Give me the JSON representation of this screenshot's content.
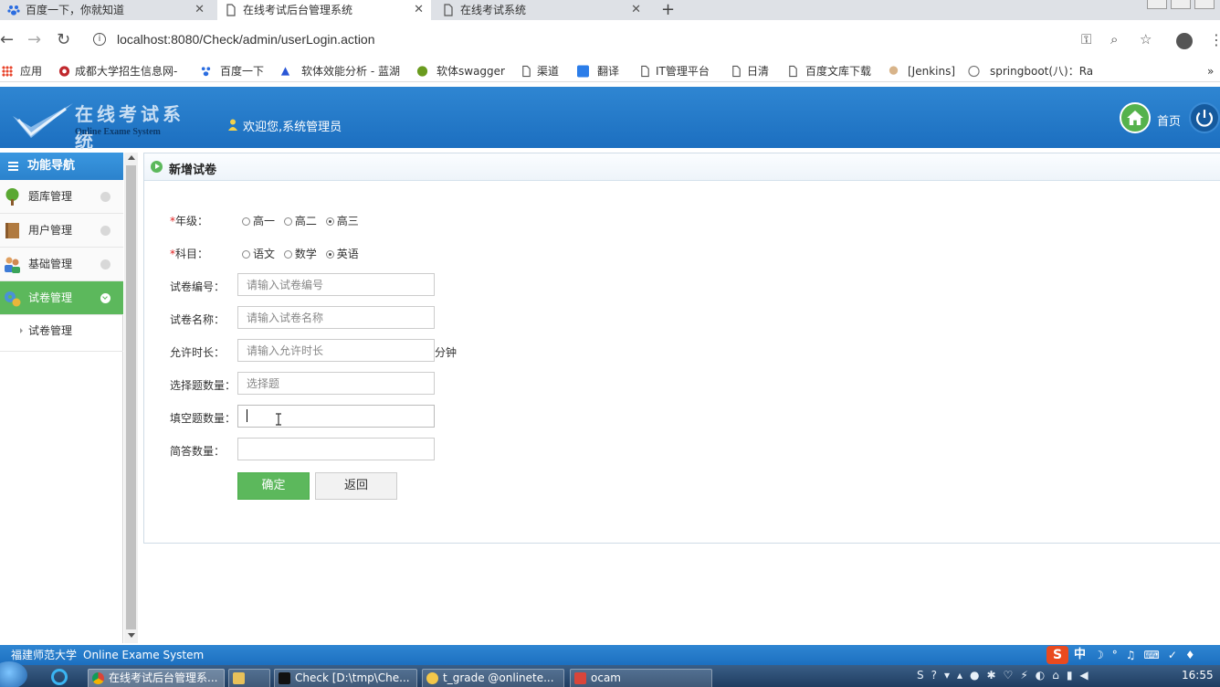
{
  "browser": {
    "tabs": [
      {
        "title": "百度一下，你就知道",
        "active": false
      },
      {
        "title": "在线考试后台管理系统",
        "active": true
      },
      {
        "title": "在线考试系统",
        "active": false
      }
    ],
    "url": "localhost:8080/Check/admin/userLogin.action",
    "bookmarks": [
      "应用",
      "成都大学招生信息网-",
      "百度一下",
      "软体效能分析 - 蓝湖",
      "软体swagger",
      "渠道",
      "翻译",
      "IT管理平台",
      "日清",
      "百度文库下载",
      "[Jenkins]",
      "springboot(八)：Ra"
    ]
  },
  "header": {
    "logo_cn": "在线考试系统",
    "logo_en": "Online Exame System",
    "welcome": "欢迎您,系统管理员",
    "home_label": "首页"
  },
  "sidebar": {
    "title": "功能导航",
    "items": [
      {
        "label": "题库管理",
        "icon": "tree-icon",
        "active": false
      },
      {
        "label": "用户管理",
        "icon": "book-icon",
        "active": false
      },
      {
        "label": "基础管理",
        "icon": "users-icon",
        "active": false
      },
      {
        "label": "试卷管理",
        "icon": "gears-icon",
        "active": true
      }
    ],
    "subitems": [
      {
        "label": "试卷管理"
      }
    ]
  },
  "panel": {
    "title": "新增试卷"
  },
  "form": {
    "grade": {
      "label": "年级：",
      "required_mark": "*",
      "options": [
        "高一",
        "高二",
        "高三"
      ],
      "selected": "高三"
    },
    "subject": {
      "label": "科目：",
      "required_mark": "*",
      "options": [
        "语文",
        "数学",
        "英语"
      ],
      "selected": "英语"
    },
    "fields": [
      {
        "label": "试卷编号：",
        "placeholder": "请输入试卷编号",
        "value": ""
      },
      {
        "label": "试卷名称：",
        "placeholder": "请输入试卷名称",
        "value": ""
      },
      {
        "label": "允许时长：",
        "placeholder": "请输入允许时长",
        "value": "",
        "unit": "分钟"
      },
      {
        "label": "选择题数量：",
        "placeholder": "选择题",
        "value": ""
      },
      {
        "label": "填空题数量：",
        "placeholder": "",
        "value": ""
      },
      {
        "label": "简答数量：",
        "placeholder": "",
        "value": ""
      }
    ],
    "submit_label": "确定",
    "back_label": "返回"
  },
  "footer": {
    "school": "福建师范大学",
    "app": "Online Exame System",
    "ime_text": "中"
  },
  "taskbar": {
    "tasks": [
      "在线考试后台管理系...",
      "Check [D:\\tmp\\Che...",
      "t_grade @onlinete...",
      "ocam"
    ],
    "clock": "16:55"
  },
  "colors": {
    "header_blue": "#2f86d2",
    "active_green": "#5cb85c",
    "required_red": "#e02020"
  }
}
